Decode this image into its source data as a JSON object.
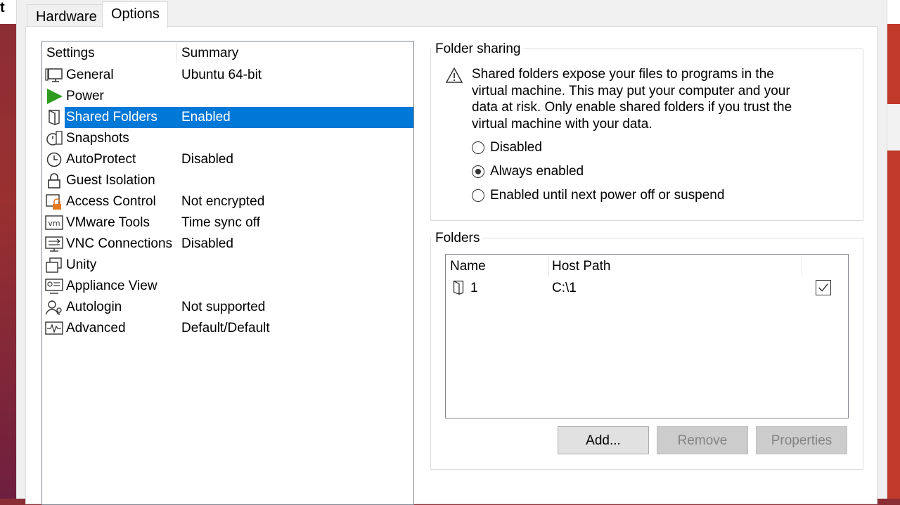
{
  "colors": {
    "accent": "#0078d7",
    "power_green": "#2e9d1f",
    "lock_orange": "#e87a1e"
  },
  "edge_text": "t",
  "tabs": [
    {
      "label": "Hardware",
      "active": false
    },
    {
      "label": "Options",
      "active": true
    }
  ],
  "settings_list": {
    "headers": {
      "settings": "Settings",
      "summary": "Summary"
    },
    "items": [
      {
        "icon": "monitor-icon",
        "label": "General",
        "summary": "Ubuntu 64-bit"
      },
      {
        "icon": "power-icon",
        "label": "Power",
        "summary": ""
      },
      {
        "icon": "shared-folder-icon",
        "label": "Shared Folders",
        "summary": "Enabled",
        "selected": true
      },
      {
        "icon": "snapshot-icon",
        "label": "Snapshots",
        "summary": ""
      },
      {
        "icon": "clock-icon",
        "label": "AutoProtect",
        "summary": "Disabled"
      },
      {
        "icon": "lock-icon",
        "label": "Guest Isolation",
        "summary": ""
      },
      {
        "icon": "access-control-icon",
        "label": "Access Control",
        "summary": "Not encrypted"
      },
      {
        "icon": "vm-icon",
        "label": "VMware Tools",
        "summary": "Time sync off"
      },
      {
        "icon": "vnc-icon",
        "label": "VNC Connections",
        "summary": "Disabled"
      },
      {
        "icon": "unity-icon",
        "label": "Unity",
        "summary": ""
      },
      {
        "icon": "appliance-icon",
        "label": "Appliance View",
        "summary": ""
      },
      {
        "icon": "autologin-icon",
        "label": "Autologin",
        "summary": "Not supported"
      },
      {
        "icon": "advanced-icon",
        "label": "Advanced",
        "summary": "Default/Default"
      }
    ]
  },
  "folder_sharing": {
    "title": "Folder sharing",
    "warning": "Shared folders expose your files to programs in the virtual machine. This may put your computer and your data at risk. Only enable shared folders if you trust the virtual machine with your data.",
    "options": [
      {
        "label": "Disabled",
        "checked": false
      },
      {
        "label": "Always enabled",
        "checked": true
      },
      {
        "label": "Enabled until next power off or suspend",
        "checked": false
      }
    ]
  },
  "folders": {
    "title": "Folders",
    "headers": {
      "name": "Name",
      "host_path": "Host Path"
    },
    "rows": [
      {
        "name": "1",
        "host_path": "C:\\1",
        "enabled": true
      }
    ],
    "buttons": {
      "add": "Add...",
      "remove": "Remove",
      "properties": "Properties"
    }
  }
}
